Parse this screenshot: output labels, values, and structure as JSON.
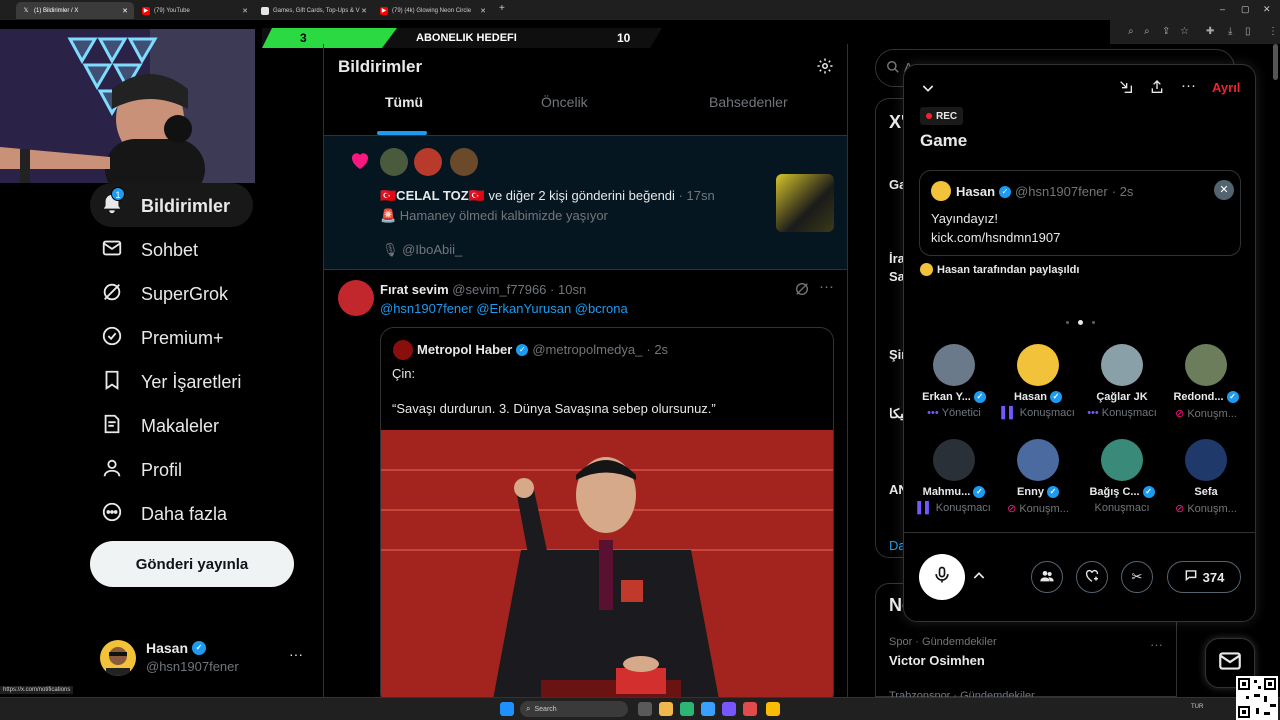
{
  "browser": {
    "tabs": [
      {
        "title": "(1) Bildirimler / X",
        "active": true
      },
      {
        "title": "(79) YouTube",
        "active": false
      },
      {
        "title": "Games, Gift Cards, Top-Ups & V",
        "active": false
      },
      {
        "title": "(79) (4k) Glowing Neon Circle",
        "active": false
      }
    ],
    "new_tab": "+",
    "status_url": "https://x.com/notifications"
  },
  "stream_banner": {
    "left_value": "3",
    "label": "ABONELIK HEDEFI",
    "right_value": "10"
  },
  "sidebar": {
    "items": [
      {
        "label": "Bildirimler",
        "badge": "1",
        "icon": "bell-icon"
      },
      {
        "label": "Sohbet",
        "icon": "mail-icon"
      },
      {
        "label": "SuperGrok",
        "icon": "grok-icon"
      },
      {
        "label": "Premium+",
        "icon": "verified-icon"
      },
      {
        "label": "Yer İşaretleri",
        "icon": "bookmark-icon"
      },
      {
        "label": "Makaleler",
        "icon": "article-icon"
      },
      {
        "label": "Profil",
        "icon": "person-icon"
      },
      {
        "label": "Daha fazla",
        "icon": "more-circle-icon"
      }
    ],
    "post_button": "Gönderi yayınla",
    "account": {
      "name": "Hasan",
      "handle": "@hsn1907fener",
      "more": "···"
    }
  },
  "main": {
    "title": "Bildirimler",
    "tabs": [
      "Tümü",
      "Öncelik",
      "Bahsedenler"
    ],
    "like_notification": {
      "text_name": "🇹🇷CELAL TOZ🇹🇷",
      "text_rest": " ve diğer 2 kişi gönderini beğendi",
      "time": "· 17sn",
      "quote": "🚨 Hamaney ölmedi kalbimizde yaşıyor",
      "mention": "🎙 @IboAbii_"
    },
    "post": {
      "name": "Fırat sevim",
      "handle": "@sevim_f77966",
      "time": "· 10sn",
      "mentions": "@hsn1907fener @ErkanYurusan @bcrona",
      "quoted": {
        "name": "Metropol Haber",
        "handle": "@metropolmedya_",
        "time": "· 2s",
        "line1": "Çin:",
        "line2": "“Savaşı durdurun. 3. Dünya Savaşına sebep olursunuz.”"
      }
    }
  },
  "space": {
    "leave": "Ayrıl",
    "rec": "REC",
    "title": "Game",
    "pinned": {
      "name": "Hasan",
      "handle": "@hsn1907fener",
      "time": "· 2s",
      "line1": "Yayındayız!",
      "line2": "kick.com/hsndmn1907",
      "shared_by": "Hasan tarafından paylaşıldı"
    },
    "speakers": [
      {
        "name": "Erkan Y...",
        "role": "Yönetici",
        "verified": true,
        "muted": false
      },
      {
        "name": "Hasan",
        "role": "Konuşmacı",
        "verified": true,
        "muted": false
      },
      {
        "name": "Çağlar JK",
        "role": "Konuşmacı",
        "verified": false,
        "muted": false
      },
      {
        "name": "Redond...",
        "role": "Konuşm...",
        "verified": true,
        "muted": true
      },
      {
        "name": "Mahmu...",
        "role": "Konuşmacı",
        "verified": true,
        "muted": false
      },
      {
        "name": "Enny",
        "role": "Konuşm...",
        "verified": true,
        "muted": true
      },
      {
        "name": "Bağış C...",
        "role": "Konuşmacı",
        "verified": true,
        "muted": false
      },
      {
        "name": "Sefa",
        "role": "Konuşm...",
        "verified": false,
        "muted": true
      }
    ],
    "comment_count": "374"
  },
  "right_column": {
    "search_placeholder": "A",
    "section_initial": "X'",
    "trend_items": [
      "Ga",
      "İra",
      "Sa",
      "Şir",
      "دانیکا",
      "AN",
      "Da"
    ],
    "news_initial": "Ne",
    "trend_meta": "Spor · Gündemdekiler",
    "trend_title": "Victor Osimhen",
    "trend_meta2": "Trabzonspor · Gündemdekiler",
    "trend_more": "···"
  },
  "taskbar": {
    "search": "Search",
    "lang": "TUR"
  },
  "colors": {
    "accent": "#1d9bf0",
    "like": "#f91880",
    "leave": "#f4212e",
    "banner_green": "#2bd943"
  }
}
